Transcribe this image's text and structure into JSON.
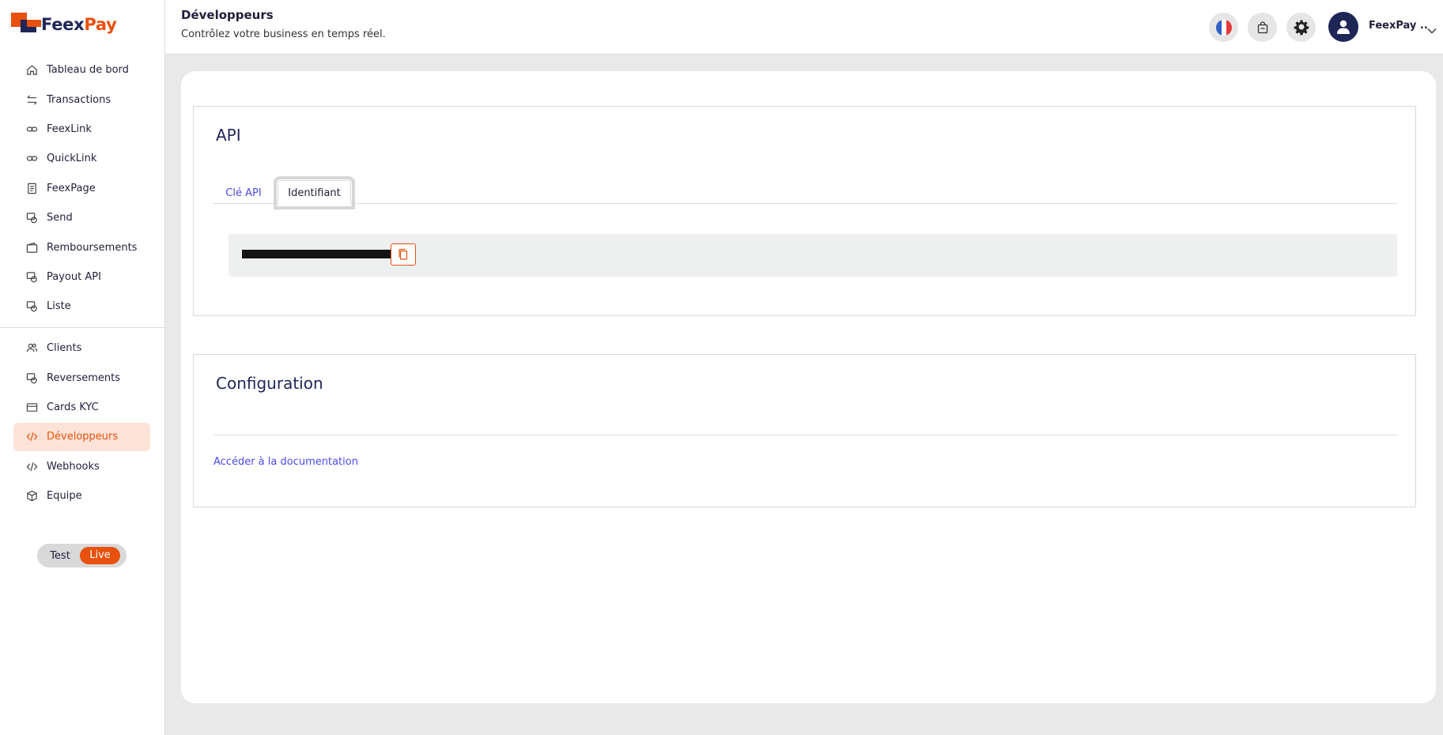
{
  "brand": {
    "name_part1": "Feex",
    "name_part2": "Pay",
    "accent": "#e8500e",
    "navy": "#1e2657"
  },
  "sidebar": {
    "group1": [
      {
        "label": "Tableau de bord",
        "icon": "home-icon"
      },
      {
        "label": "Transactions",
        "icon": "transfer-arrows-icon"
      },
      {
        "label": "FeexLink",
        "icon": "link-icon"
      },
      {
        "label": "QuickLink",
        "icon": "link-icon"
      },
      {
        "label": "FeexPage",
        "icon": "page-icon"
      },
      {
        "label": "Send",
        "icon": "send-money-icon"
      },
      {
        "label": "Remboursements",
        "icon": "wallet-icon"
      },
      {
        "label": "Payout API",
        "icon": "payout-icon"
      },
      {
        "label": "Liste",
        "icon": "list-icon"
      }
    ],
    "group2": [
      {
        "label": "Clients",
        "icon": "users-icon"
      },
      {
        "label": "Reversements",
        "icon": "reversal-icon"
      },
      {
        "label": "Cards KYC",
        "icon": "card-icon"
      },
      {
        "label": "Développeurs",
        "icon": "code-icon",
        "active": true
      },
      {
        "label": "Webhooks",
        "icon": "code-icon"
      },
      {
        "label": "Equipe",
        "icon": "box-icon"
      }
    ],
    "mode_toggle": {
      "test_label": "Test",
      "live_label": "Live",
      "selected": "Live"
    }
  },
  "header": {
    "title": "Développeurs",
    "subtitle": "Contrôlez votre business en temps réel.",
    "user_name": "FeexPay .."
  },
  "api_panel": {
    "title": "API",
    "tabs": [
      {
        "label": "Clé API"
      },
      {
        "label": "Identifiant",
        "selected": true
      }
    ]
  },
  "config_panel": {
    "title": "Configuration",
    "doc_link": "Accéder à la documentation"
  }
}
